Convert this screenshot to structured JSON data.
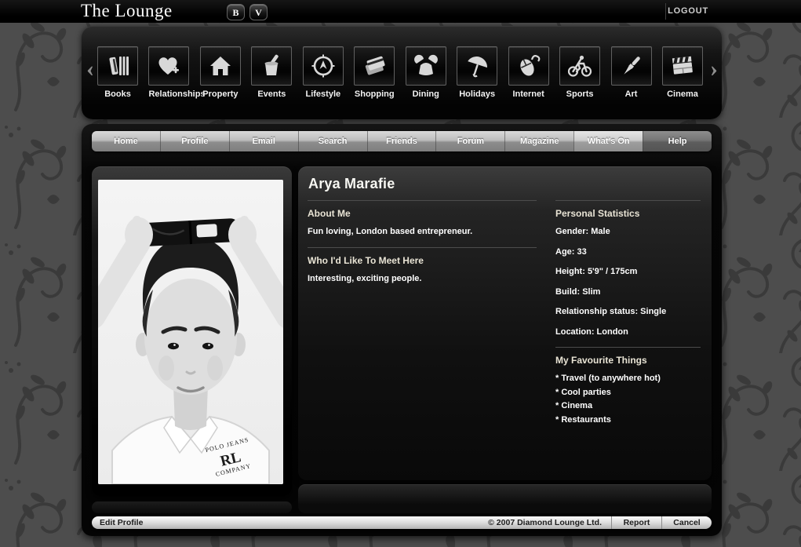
{
  "topbar": {
    "title": "The Lounge",
    "badges": [
      "B",
      "V"
    ],
    "logout": "LOGOUT"
  },
  "carousel": {
    "left_arrow": "‹",
    "right_arrow": "›",
    "categories": [
      {
        "label": "Books",
        "icon": "books-icon"
      },
      {
        "label": "Relationships",
        "icon": "heart-plus-icon"
      },
      {
        "label": "Property",
        "icon": "house-icon"
      },
      {
        "label": "Events",
        "icon": "champagne-bucket-icon"
      },
      {
        "label": "Lifestyle",
        "icon": "compass-icon"
      },
      {
        "label": "Shopping",
        "icon": "credit-cards-icon"
      },
      {
        "label": "Dining",
        "icon": "crab-icon"
      },
      {
        "label": "Holidays",
        "icon": "umbrella-icon"
      },
      {
        "label": "Internet",
        "icon": "mouse-icon"
      },
      {
        "label": "Sports",
        "icon": "cyclist-icon"
      },
      {
        "label": "Art",
        "icon": "paintbrush-icon"
      },
      {
        "label": "Cinema",
        "icon": "clapperboard-icon"
      }
    ]
  },
  "nav": {
    "tabs": [
      "Home",
      "Profile",
      "Email",
      "Search",
      "Friends",
      "Forum",
      "Magazine",
      "What's On",
      "Help"
    ]
  },
  "profile": {
    "name": "Arya Marafie",
    "about": {
      "heading": "About Me",
      "text": "Fun loving, London based entrepreneur."
    },
    "meet": {
      "heading": "Who I'd Like To Meet Here",
      "text": "Interesting, exciting people."
    },
    "stats": {
      "heading": "Personal Statistics",
      "rows": [
        "Gender: Male",
        "Age: 33",
        "Height: 5'9\" / 175cm",
        "Build: Slim",
        "Relationship status: Single",
        "Location: London"
      ]
    },
    "favourites": {
      "heading": "My Favourite Things",
      "items": [
        "* Travel (to anywhere hot)",
        "* Cool parties",
        "* Cinema",
        "* Restaurants"
      ]
    },
    "photo_watermark": {
      "arc_top": "POLO JEANS",
      "monogram": "RL",
      "arc_bottom": "COMPANY"
    }
  },
  "footer": {
    "edit_profile": "Edit Profile",
    "copyright": "© 2007 Diamond Lounge Ltd.",
    "report": "Report",
    "cancel": "Cancel"
  },
  "colors": {
    "heading_cream": "#e9e4d5",
    "wallpaper_base": "#4d4d4d",
    "wallpaper_motif": "#3a3a3a",
    "tab_silver": "#bdbdbd",
    "panel_black": "#0a0a0a"
  }
}
